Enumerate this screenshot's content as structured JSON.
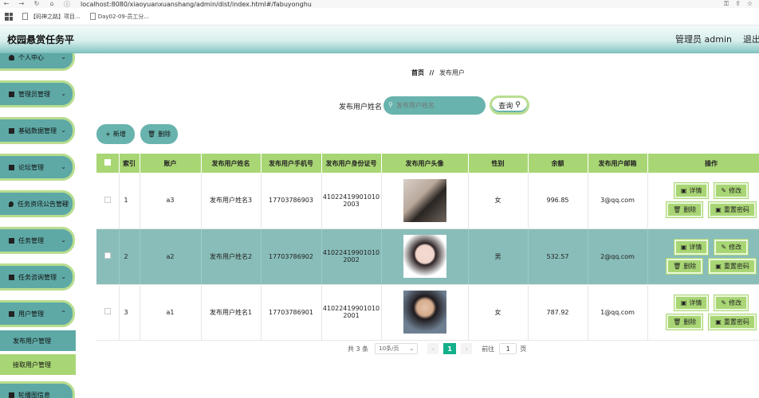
{
  "browser": {
    "url": "localhost:8080/xiaoyuanxuanshang/admin/dist/index.html#/fabuyonghu",
    "bookmarks": [
      "【码神之路】项目...",
      "Day02-09-员工分..."
    ]
  },
  "header": {
    "title": "校园悬赏任务平",
    "admin": "管理员 admin",
    "logout": "退出"
  },
  "sidebar": {
    "items": [
      {
        "label": "个人中心",
        "icon": "person-icon"
      },
      {
        "label": "管理员管理",
        "icon": "grid-icon"
      },
      {
        "label": "基础数据管理",
        "icon": "box-icon"
      },
      {
        "label": "论坛管理",
        "icon": "grid-icon"
      },
      {
        "label": "任务资讯公告管理",
        "icon": "pin-icon"
      },
      {
        "label": "任务管理",
        "icon": "apps-icon"
      },
      {
        "label": "任务咨询管理",
        "icon": "apps-icon"
      },
      {
        "label": "用户管理",
        "icon": "grid-icon"
      }
    ],
    "subitems": [
      "发布用户管理",
      "接取用户管理"
    ],
    "bottom_item": "轮播图信息"
  },
  "breadcrumb": {
    "home": "首页",
    "sep": "//",
    "current": "发布用户"
  },
  "search": {
    "label": "发布用户姓名",
    "placeholder": "发布用户姓名",
    "button": "查询"
  },
  "actions": {
    "add": "新增",
    "delete": "删除"
  },
  "table": {
    "headers": [
      "",
      "索引",
      "账户",
      "发布用户姓名",
      "发布用户手机号",
      "发布用户身份证号",
      "发布用户头像",
      "性别",
      "余额",
      "发布用户邮箱",
      "操作"
    ],
    "rows": [
      {
        "index": "1",
        "account": "a3",
        "name": "发布用户姓名3",
        "phone": "17703786903",
        "id_line1": "41022419901010",
        "id_line2": "2003",
        "gender": "女",
        "balance": "996.85",
        "email": "3@qq.com"
      },
      {
        "index": "2",
        "account": "a2",
        "name": "发布用户姓名2",
        "phone": "17703786902",
        "id_line1": "41022419901010",
        "id_line2": "2002",
        "gender": "男",
        "balance": "532.57",
        "email": "2@qq.com"
      },
      {
        "index": "3",
        "account": "a1",
        "name": "发布用户姓名1",
        "phone": "17703786901",
        "id_line1": "41022419901010",
        "id_line2": "2001",
        "gender": "女",
        "balance": "787.92",
        "email": "1@qq.com"
      }
    ],
    "ops": {
      "detail": "详情",
      "edit": "修改",
      "delete": "删除",
      "reset": "重置密码"
    }
  },
  "pagination": {
    "total": "共 3 条",
    "page_size": "10条/页",
    "current": "1",
    "goto_label": "前往",
    "goto_value": "1",
    "unit": "页"
  },
  "colors": {
    "accent": "#68b3ad",
    "header_green": "#a9d675",
    "selected_row": "#89bdb9",
    "page_current": "#13b08b"
  }
}
